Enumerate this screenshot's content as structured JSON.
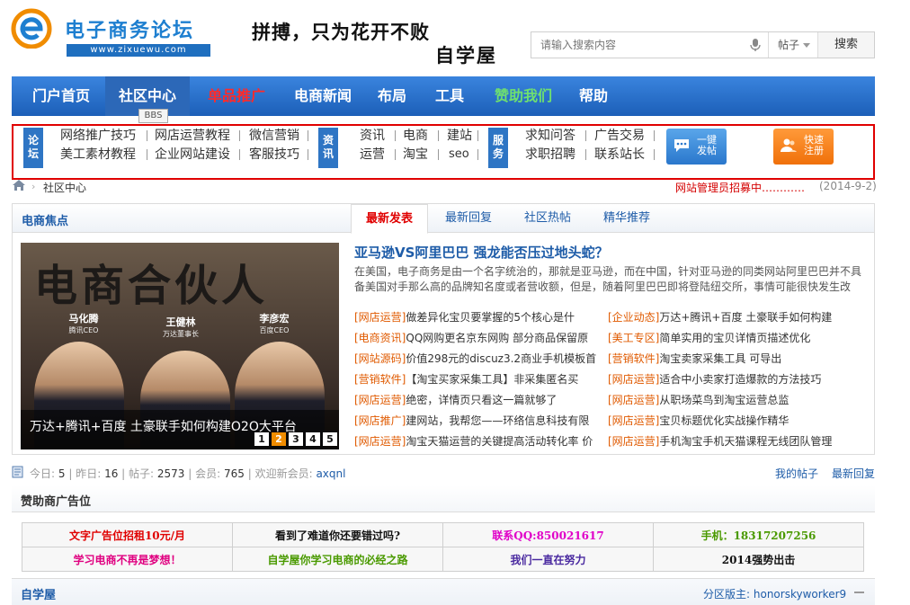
{
  "header": {
    "site_title": "电子商务论坛",
    "site_url": "www.zixuewu.com",
    "slogan_line1": "拼搏，只为花开不败",
    "slogan_line2": "自学屋",
    "search_placeholder": "请输入搜索内容",
    "search_type": "帖子",
    "search_button": "搜索"
  },
  "nav": {
    "items": [
      {
        "label": "门户首页"
      },
      {
        "label": "社区中心"
      },
      {
        "label": "单品推广"
      },
      {
        "label": "电商新闻"
      },
      {
        "label": "布局"
      },
      {
        "label": "工具"
      },
      {
        "label": "赞助我们"
      },
      {
        "label": "帮助"
      }
    ],
    "tooltip": "BBS"
  },
  "quick": {
    "forum_tag": "论坛",
    "forum_links": [
      "网络推广技巧",
      "网店运营教程",
      "微信营销",
      "美工素材教程",
      "企业网站建设",
      "客服技巧"
    ],
    "info_tag": "资讯",
    "info_links": [
      "资讯",
      "电商",
      "建站",
      "运营",
      "淘宝",
      "seo"
    ],
    "service_tag": "服务",
    "service_links": [
      "求知问答",
      "广告交易",
      "求职招聘",
      "联系站长"
    ],
    "post_button": "一键发帖",
    "register_button": "快速注册"
  },
  "breadcrumb": {
    "current": "社区中心",
    "notice": "网站管理员招募中…………",
    "notice_date": "(2014-9-2)"
  },
  "focus": {
    "title": "电商焦点",
    "tabs": [
      "最新发表",
      "最新回复",
      "社区热帖",
      "精华推荐"
    ],
    "banner": {
      "big_title": "电商合伙人",
      "people": [
        {
          "name": "马化腾",
          "role": "腾讯CEO"
        },
        {
          "name": "王健林",
          "role": "万达董事长"
        },
        {
          "name": "李彦宏",
          "role": "百度CEO"
        }
      ],
      "caption": "万达+腾讯+百度 土豪联手如何构建O2O大平台",
      "pages": [
        "1",
        "2",
        "3",
        "4",
        "5"
      ],
      "current_page": "2"
    },
    "headline": "亚马逊VS阿里巴巴 强龙能否压过地头蛇？",
    "headline_desc": "在美国，电子商务是由一个名字统治的，那就是亚马逊，而在中国，针对亚马逊的同类网站阿里巴巴并不具备美国对手那么高的品牌知名度或者营收额，但是，随着阿里巴巴即将登陆纽交所，事情可能很快发生改",
    "news_left": [
      {
        "tag": "[网店运营]",
        "title": "做差异化宝贝要掌握的5个核心是什"
      },
      {
        "tag": "[电商资讯]",
        "title": "QQ网购更名京东网购 部分商品保留原"
      },
      {
        "tag": "[网站源码]",
        "title": "价值298元的discuz3.2商业手机模板首"
      },
      {
        "tag": "[营销软件]",
        "title": "【淘宝买家采集工具】非采集匿名买"
      },
      {
        "tag": "[网店运营]",
        "title": "绝密，详情页只看这一篇就够了"
      },
      {
        "tag": "[网店推广]",
        "title": "建网站，我帮您——环络信息科技有限"
      },
      {
        "tag": "[网店运营]",
        "title": "淘宝天猫运营的关键提高活动转化率 价"
      }
    ],
    "news_right": [
      {
        "tag": "[企业动态]",
        "title": "万达+腾讯+百度 土豪联手如何构建"
      },
      {
        "tag": "[美工专区]",
        "title": "简单实用的宝贝详情页描述优化"
      },
      {
        "tag": "[营销软件]",
        "title": "淘宝卖家采集工具 可导出"
      },
      {
        "tag": "[网店运营]",
        "title": "适合中小卖家打造爆款的方法技巧"
      },
      {
        "tag": "[网店运营]",
        "title": "从职场菜鸟到淘宝运营总监"
      },
      {
        "tag": "[网店运营]",
        "title": "宝贝标题优化实战操作精华"
      },
      {
        "tag": "[网店运营]",
        "title": "手机淘宝手机天猫课程无线团队管理"
      }
    ]
  },
  "stats": {
    "today_label": "今日:",
    "today": "5",
    "yesterday_label": "昨日:",
    "yesterday": "16",
    "posts_label": "帖子:",
    "posts": "2573",
    "members_label": "会员:",
    "members": "765",
    "welcome_label": "欢迎新会员:",
    "new_member": "axqnl",
    "my_posts": "我的帖子",
    "latest_reply": "最新回复"
  },
  "sponsor": {
    "title": "赞助商广告位",
    "rows": [
      [
        {
          "text": "文字广告位招租10元/月",
          "color": "#e00000"
        },
        {
          "text": "看到了难道你还要错过吗?",
          "color": "#111111"
        },
        {
          "text": "联系QQ:850021617",
          "color": "#e000c8"
        },
        {
          "text": "手机：18317207256",
          "color": "#4a9a00"
        }
      ],
      [
        {
          "text": "学习电商不再是梦想！",
          "color": "#e00080"
        },
        {
          "text": "自学屋你学习电商的必经之路",
          "color": "#4a9a00"
        },
        {
          "text": "我们一直在努力",
          "color": "#4a2aa0"
        },
        {
          "text": "2014强势出击",
          "color": "#111111"
        }
      ]
    ]
  },
  "section": {
    "name": "自学屋",
    "moderator_label": "分区版主:",
    "moderator": "honorskyworker9"
  },
  "colors": {
    "nav_blue": "#2c68b8",
    "accent_red": "#e00000",
    "link_blue": "#1e5ca8",
    "tag_orange": "#e05a00"
  }
}
